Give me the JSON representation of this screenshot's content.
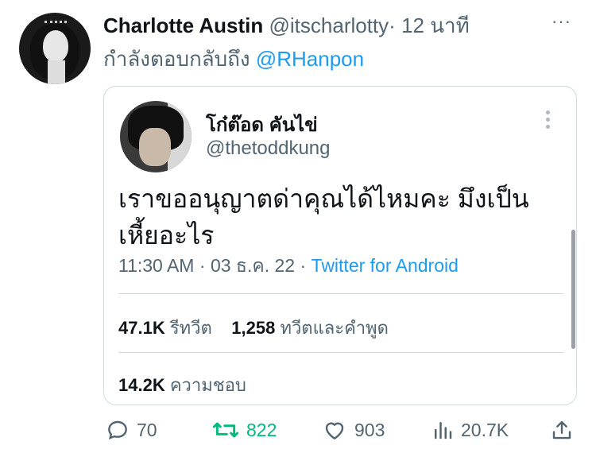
{
  "tweet": {
    "author_name": "Charlotte Austin",
    "author_handle": "@itscharlotty",
    "separator": "·",
    "time": "12 นาที",
    "more": "···",
    "reply_prefix": "กำลังตอบกลับถึง",
    "reply_mention": "@RHanpon"
  },
  "quoted": {
    "name": "โก๋ต๊อด คันไข่",
    "handle": "@thetoddkung",
    "text": "เราขออนุญาตด่าคุณได้ไหมคะ มึงเป็นเหี้ยอะไร",
    "time": "11:30 AM",
    "date": "03 ธ.ค. 22",
    "source": "Twitter for Android",
    "retweets_count": "47.1K",
    "retweets_label": "รีทวีต",
    "quotes_count": "1,258",
    "quotes_label": "ทวีตและคำพูด",
    "likes_count": "14.2K",
    "likes_label": "ความชอบ"
  },
  "actions": {
    "replies": "70",
    "retweets": "822",
    "likes": "903",
    "views": "20.7K"
  },
  "colors": {
    "accent": "#1d9bf0",
    "retweet_green": "#00ba7c",
    "muted": "#536471",
    "border": "#cfd9de"
  }
}
